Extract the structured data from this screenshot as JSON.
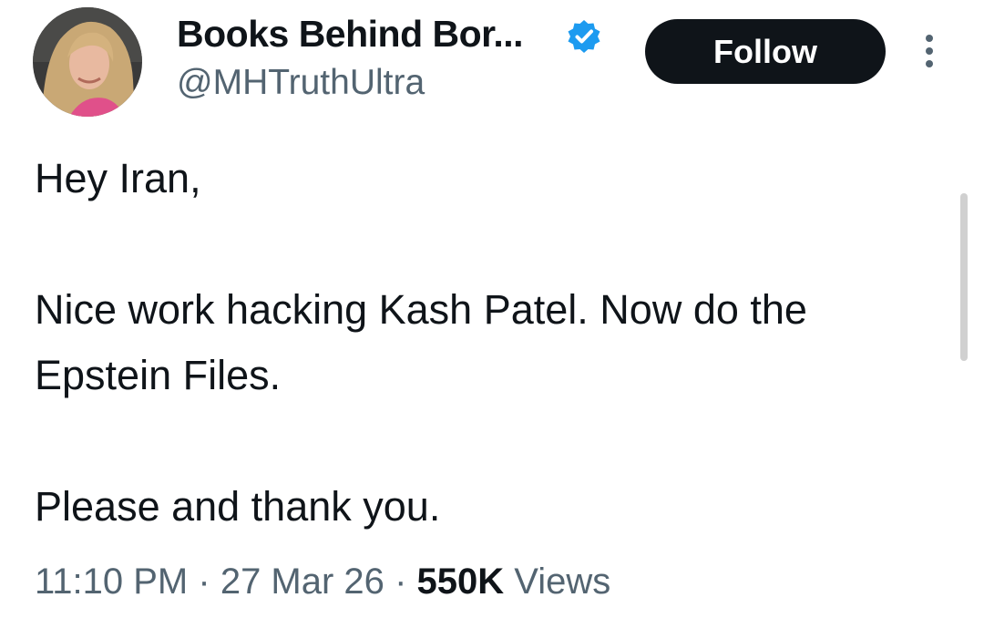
{
  "header": {
    "display_name": "Books Behind Bor...",
    "handle": "@MHTruthUltra",
    "verified": true,
    "follow_label": "Follow",
    "avatar_icon": "profile-photo-avatar",
    "verified_icon": "verified-badge-icon",
    "more_icon": "more-vertical-icon"
  },
  "tweet": {
    "paragraphs": [
      "Hey Iran,",
      "Nice work hacking Kash Patel. Now do the Epstein Files.",
      "Please and thank you."
    ]
  },
  "meta": {
    "time": "11:10 PM",
    "separator": "·",
    "date": "27 Mar 26",
    "views_count": "550K",
    "views_label": "Views"
  },
  "colors": {
    "text": "#0f1419",
    "secondary": "#536471",
    "verified": "#1d9bf0",
    "button_bg": "#0f1419",
    "button_text": "#ffffff"
  }
}
